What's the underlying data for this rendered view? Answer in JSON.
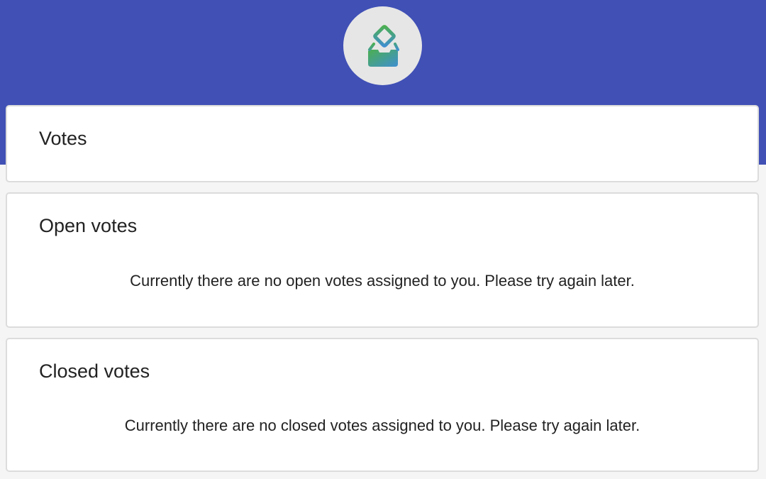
{
  "header": {
    "logo_icon": "ballot-box-icon",
    "background_color": "#4050b5",
    "logo_gradient": [
      "#4caf50",
      "#3f8fd0"
    ]
  },
  "sections": {
    "votes": {
      "title": "Votes"
    },
    "open": {
      "title": "Open votes",
      "message": "Currently there are no open votes assigned to you. Please try again later."
    },
    "closed": {
      "title": "Closed votes",
      "message": "Currently there are no closed votes assigned to you. Please try again later."
    }
  }
}
